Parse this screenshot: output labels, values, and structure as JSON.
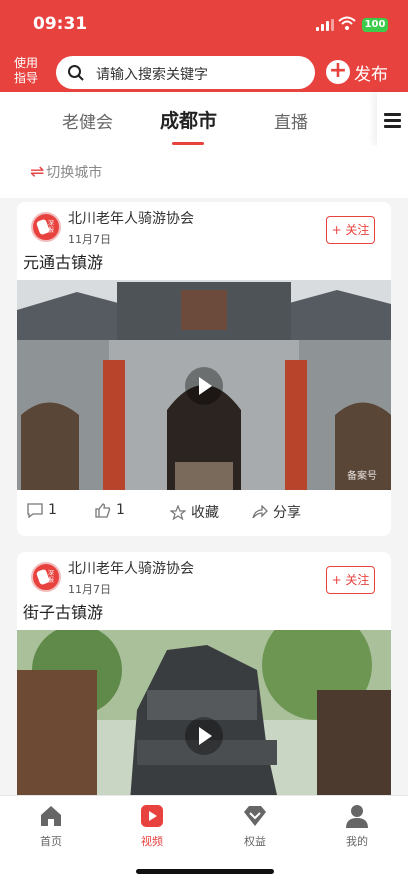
{
  "status": {
    "time": "09:31",
    "battery": "100"
  },
  "header": {
    "login_label": "使用指导",
    "search_placeholder": "请输入搜索关键字",
    "publish_label": "发布"
  },
  "tabs": [
    {
      "label": "老健会"
    },
    {
      "label": "成都市"
    },
    {
      "label": "直播"
    }
  ],
  "switch_city": "切换城市",
  "posts": [
    {
      "author": "北川老年人骑游协会",
      "date": "11月7日",
      "follow": "+ 关注",
      "title": "元通古镇游",
      "watermark": "备案号",
      "avatar_text": "深报",
      "comments": "1",
      "likes": "1",
      "collect": "收藏",
      "share": "分享"
    },
    {
      "author": "北川老年人骑游协会",
      "date": "11月7日",
      "follow": "+ 关注",
      "title": "街子古镇游",
      "avatar_text": "深报"
    }
  ],
  "bottom_nav": [
    {
      "label": "首页"
    },
    {
      "label": "视频"
    },
    {
      "label": "权益"
    },
    {
      "label": "我的"
    }
  ],
  "colors": {
    "brand": "#e8423f"
  }
}
